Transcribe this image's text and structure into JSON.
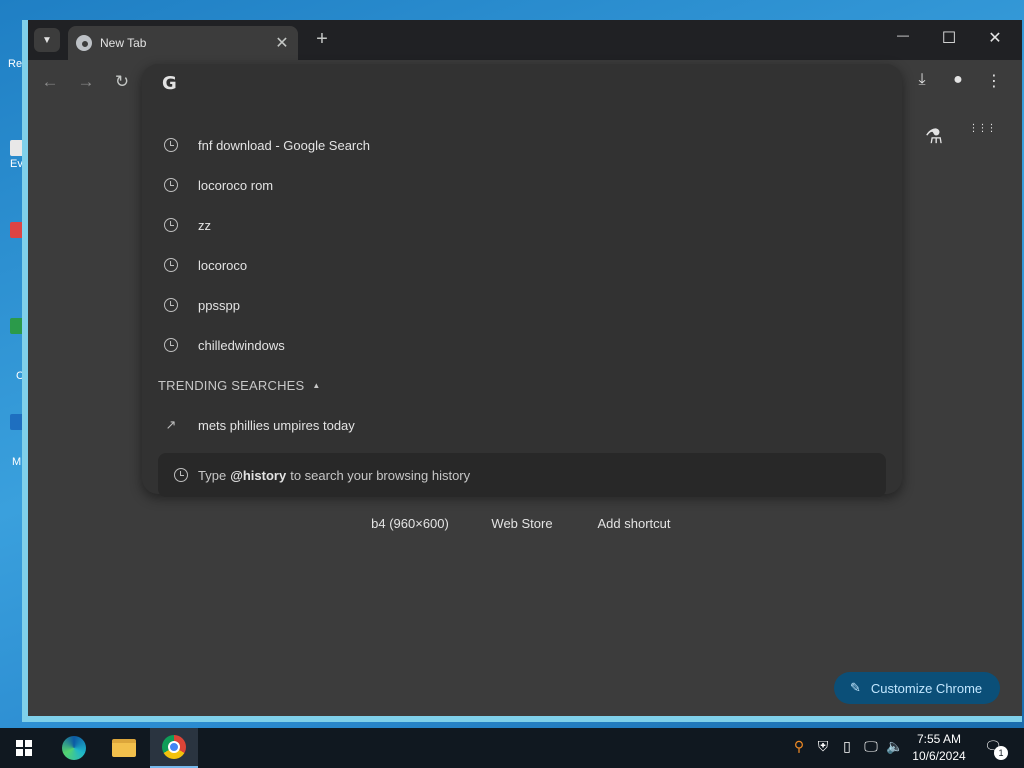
{
  "desktop": {
    "fragments": [
      "Re",
      "Ev",
      "C",
      "M"
    ]
  },
  "browser": {
    "tab": {
      "title": "New Tab",
      "close_glyph": "✕"
    },
    "new_tab_glyph": "+",
    "window_controls": {
      "minimize": "—",
      "maximize": "☐",
      "close": "✕"
    },
    "nav": {
      "back": "←",
      "forward": "→",
      "reload": "↻"
    },
    "toolbar_right": {
      "download": "⤓",
      "profile": "●",
      "menu": "⋮"
    }
  },
  "omnibox": {
    "logo": "G",
    "input_value": "",
    "suggestions": [
      {
        "text": "fnf download - Google Search"
      },
      {
        "text": "locoroco rom"
      },
      {
        "text": "zz"
      },
      {
        "text": "locoroco"
      },
      {
        "text": "ppsspp"
      },
      {
        "text": "chilledwindows"
      }
    ],
    "trending_header": "TRENDING SEARCHES",
    "trending": [
      {
        "text": "mets phillies umpires today"
      }
    ],
    "history_tip": {
      "prefix": "Type",
      "keyword": "@history",
      "suffix": "to search your browsing history"
    }
  },
  "ntp": {
    "labs_icon": "⚗",
    "apps_icon": "⋮⋮⋮",
    "shortcuts": [
      {
        "label": "b4 (960×600)"
      },
      {
        "label": "Web Store"
      },
      {
        "label": "Add shortcut"
      }
    ],
    "customize_label": "Customize Chrome"
  },
  "taskbar": {
    "time": "7:55 AM",
    "date": "10/6/2024",
    "notification_count": "1"
  },
  "colors": {
    "accent": "#0b4f78",
    "accent_text": "#c2e7ff",
    "window_border": "#7fd0ea"
  }
}
